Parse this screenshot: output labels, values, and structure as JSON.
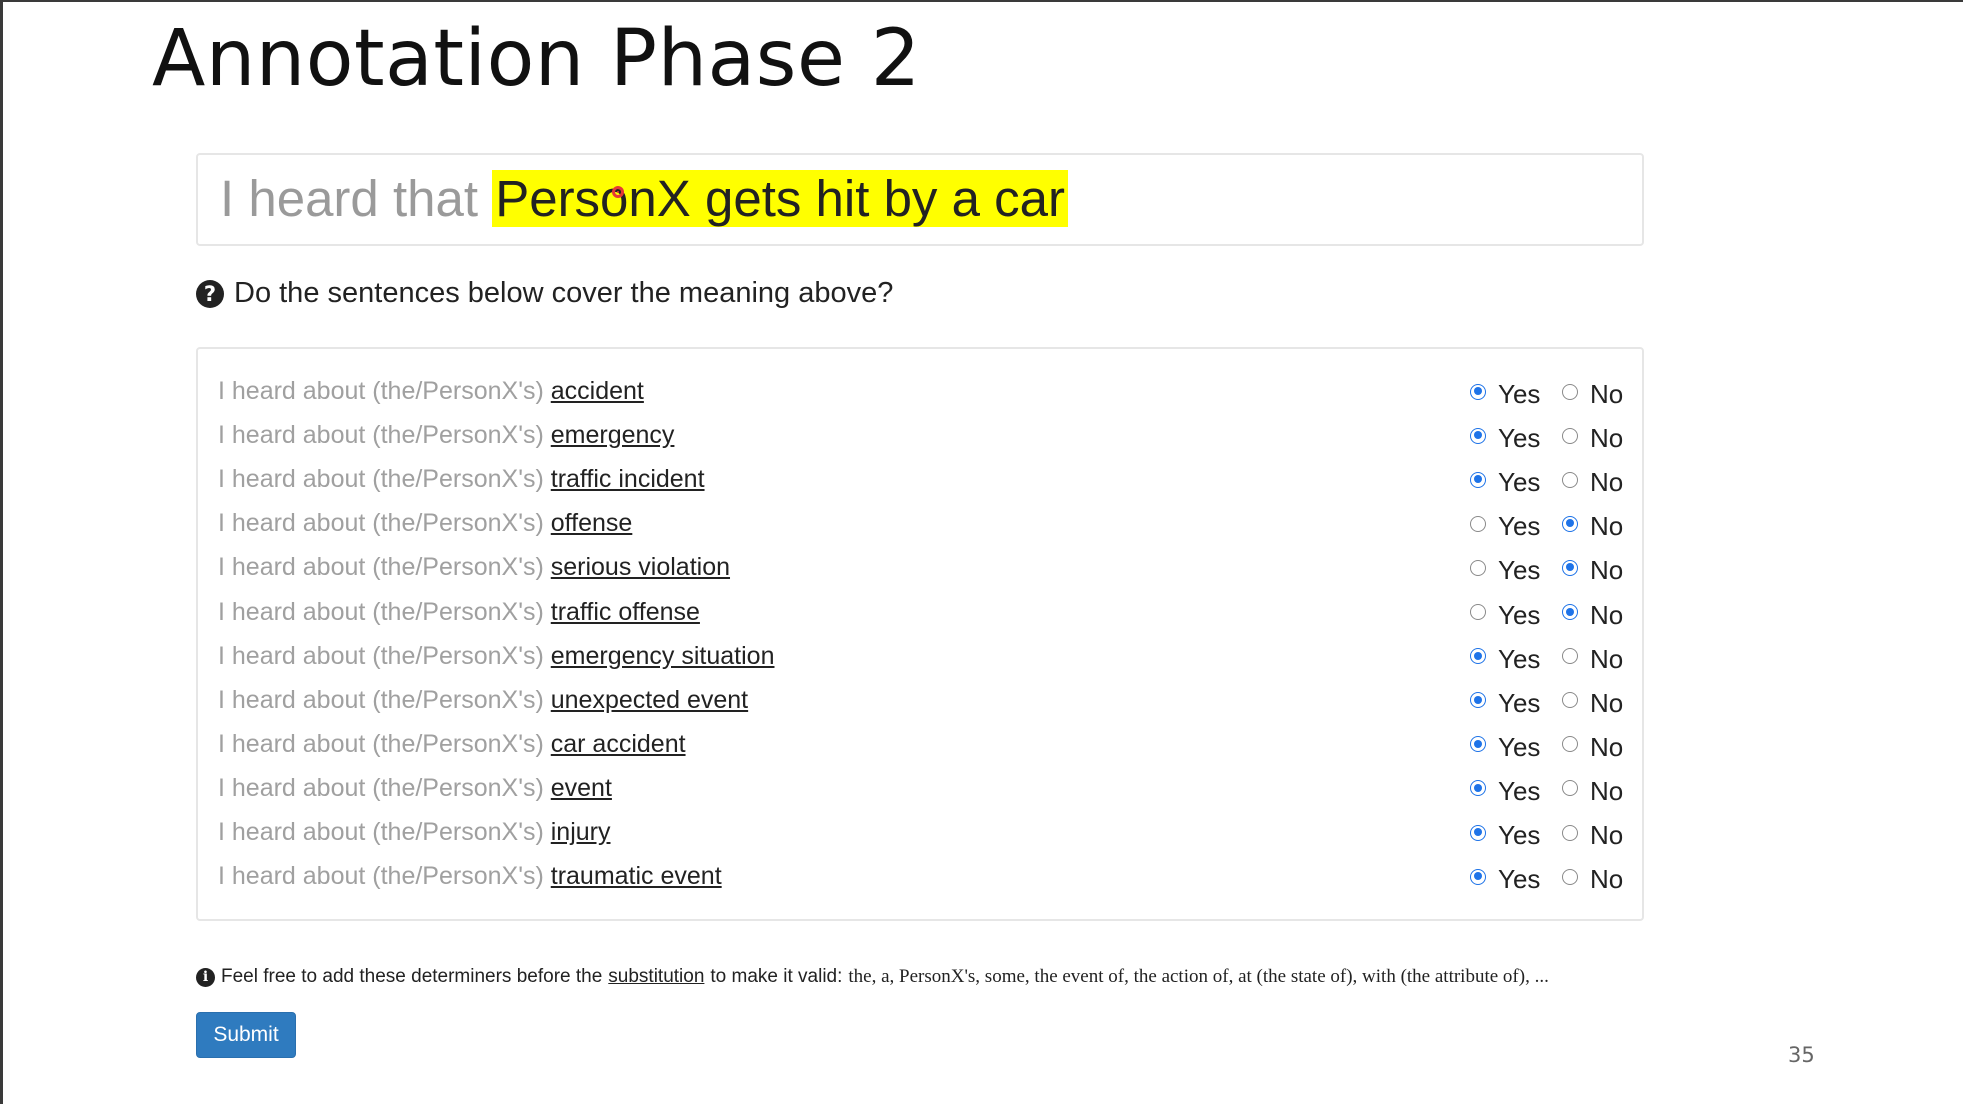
{
  "slide": {
    "title": "Annotation Phase 2",
    "page_number": "35"
  },
  "premise": {
    "prefix": "I heard that",
    "highlight": "PersonX gets hit by a car"
  },
  "question": {
    "icon": "question-circle-icon",
    "text": "Do the sentences below cover the meaning above?"
  },
  "options": {
    "yes_label": "Yes",
    "no_label": "No"
  },
  "rows": [
    {
      "prefix": "I heard about (the/PersonX's)",
      "substitution": "accident",
      "answer": "Yes"
    },
    {
      "prefix": "I heard about (the/PersonX's)",
      "substitution": "emergency",
      "answer": "Yes"
    },
    {
      "prefix": "I heard about (the/PersonX's)",
      "substitution": "traffic incident",
      "answer": "Yes"
    },
    {
      "prefix": "I heard about (the/PersonX's)",
      "substitution": "offense",
      "answer": "No"
    },
    {
      "prefix": "I heard about (the/PersonX's)",
      "substitution": "serious violation",
      "answer": "No"
    },
    {
      "prefix": "I heard about (the/PersonX's)",
      "substitution": "traffic offense",
      "answer": "No"
    },
    {
      "prefix": "I heard about (the/PersonX's)",
      "substitution": "emergency situation",
      "answer": "Yes"
    },
    {
      "prefix": "I heard about (the/PersonX's)",
      "substitution": "unexpected event",
      "answer": "Yes"
    },
    {
      "prefix": "I heard about (the/PersonX's)",
      "substitution": "car accident",
      "answer": "Yes"
    },
    {
      "prefix": "I heard about (the/PersonX's)",
      "substitution": "event",
      "answer": "Yes"
    },
    {
      "prefix": "I heard about (the/PersonX's)",
      "substitution": "injury",
      "answer": "Yes"
    },
    {
      "prefix": "I heard about (the/PersonX's)",
      "substitution": "traumatic event",
      "answer": "Yes"
    }
  ],
  "hint": {
    "icon": "info-circle-icon",
    "before_link": "Feel free to add these determiners before the",
    "link": "substitution",
    "after_link": "to make it valid:",
    "determiners": "the, a, PersonX's, some, the event of, the action of, at (the state of), with (the attribute of), ..."
  },
  "submit_label": "Submit",
  "colors": {
    "highlight": "#ffff00",
    "radio_checked": "#1e73e8",
    "submit_button": "#2f7bbf",
    "cursor_marker": "#e53935"
  }
}
